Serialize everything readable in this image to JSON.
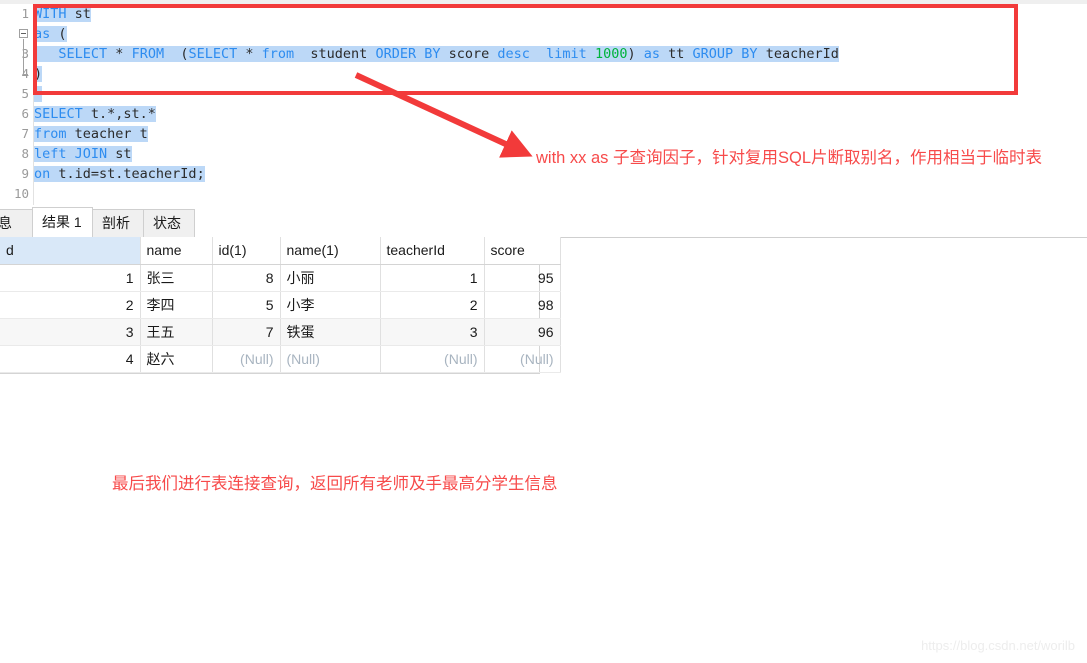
{
  "editor": {
    "line_numbers": [
      "1",
      "2",
      "3",
      "4",
      "5",
      "6",
      "7",
      "8",
      "9",
      "10"
    ],
    "lines": [
      {
        "n": "1",
        "text": "WITH st"
      },
      {
        "n": "2",
        "text": "as ("
      },
      {
        "n": "3",
        "text": "   SELECT * FROM  (SELECT * from  student ORDER BY score desc  limit 1000) as tt GROUP BY teacherId"
      },
      {
        "n": "4",
        "text": ")"
      },
      {
        "n": "5",
        "text": ""
      },
      {
        "n": "6",
        "text": "SELECT t.*,st.*"
      },
      {
        "n": "7",
        "text": "from teacher t"
      },
      {
        "n": "8",
        "text": "left JOIN st"
      },
      {
        "n": "9",
        "text": "on t.id=st.teacherId;"
      },
      {
        "n": "10",
        "text": ""
      }
    ],
    "tokens": {
      "l1": [
        {
          "t": "WITH",
          "c": "kw"
        },
        {
          "t": " st",
          "c": "plain"
        }
      ],
      "l2": [
        {
          "t": "as",
          "c": "kw"
        },
        {
          "t": " (",
          "c": "plain"
        }
      ],
      "l3": [
        {
          "t": "   ",
          "c": "plain"
        },
        {
          "t": "SELECT",
          "c": "kw"
        },
        {
          "t": " * ",
          "c": "plain"
        },
        {
          "t": "FROM",
          "c": "kw"
        },
        {
          "t": "  (",
          "c": "plain"
        },
        {
          "t": "SELECT",
          "c": "kw"
        },
        {
          "t": " * ",
          "c": "plain"
        },
        {
          "t": "from",
          "c": "kw"
        },
        {
          "t": "  student ",
          "c": "plain"
        },
        {
          "t": "ORDER",
          "c": "kw"
        },
        {
          "t": " ",
          "c": "plain"
        },
        {
          "t": "BY",
          "c": "kw"
        },
        {
          "t": " score ",
          "c": "plain"
        },
        {
          "t": "desc",
          "c": "kw"
        },
        {
          "t": "  ",
          "c": "plain"
        },
        {
          "t": "limit",
          "c": "kw"
        },
        {
          "t": " ",
          "c": "plain"
        },
        {
          "t": "1000",
          "c": "num"
        },
        {
          "t": ") ",
          "c": "plain"
        },
        {
          "t": "as",
          "c": "kw"
        },
        {
          "t": " tt ",
          "c": "plain"
        },
        {
          "t": "GROUP",
          "c": "kw"
        },
        {
          "t": " ",
          "c": "plain"
        },
        {
          "t": "BY",
          "c": "kw"
        },
        {
          "t": " teacherId",
          "c": "plain"
        }
      ],
      "l4": [
        {
          "t": ")",
          "c": "plain"
        }
      ],
      "l6": [
        {
          "t": "SELECT",
          "c": "kw"
        },
        {
          "t": " t.*,st.*",
          "c": "plain"
        }
      ],
      "l7": [
        {
          "t": "from",
          "c": "kw"
        },
        {
          "t": " teacher t",
          "c": "plain"
        }
      ],
      "l8": [
        {
          "t": "left",
          "c": "kw"
        },
        {
          "t": " ",
          "c": "plain"
        },
        {
          "t": "JOIN",
          "c": "kw"
        },
        {
          "t": " st",
          "c": "plain"
        }
      ],
      "l9": [
        {
          "t": "on",
          "c": "kw"
        },
        {
          "t": " t.id=st.teacherId;",
          "c": "plain"
        }
      ]
    }
  },
  "annotations": {
    "box_color": "#f23a3a",
    "arrow_color": "#f23a3a",
    "text_color": "#f74a4a",
    "callout_top": "with xx as 子查询因子，针对复用SQL片断取别名，作用相当于临时表",
    "callout_bottom": "最后我们进行表连接查询，返回所有老师及手最高分学生信息"
  },
  "tabs": [
    {
      "label": "息",
      "active": false
    },
    {
      "label": "结果 1",
      "active": true
    },
    {
      "label": "剖析",
      "active": false
    },
    {
      "label": "状态",
      "active": false
    }
  ],
  "result_grid": {
    "columns": [
      "d",
      "name",
      "id(1)",
      "name(1)",
      "teacherId",
      "score"
    ],
    "rows": [
      {
        "cells": [
          {
            "v": "1",
            "type": "num"
          },
          {
            "v": "张三",
            "type": "txt"
          },
          {
            "v": "8",
            "type": "num"
          },
          {
            "v": "小丽",
            "type": "txt"
          },
          {
            "v": "1",
            "type": "num"
          },
          {
            "v": "95",
            "type": "num"
          }
        ]
      },
      {
        "cells": [
          {
            "v": "2",
            "type": "num"
          },
          {
            "v": "李四",
            "type": "txt"
          },
          {
            "v": "5",
            "type": "num"
          },
          {
            "v": "小李",
            "type": "txt"
          },
          {
            "v": "2",
            "type": "num"
          },
          {
            "v": "98",
            "type": "num"
          }
        ]
      },
      {
        "cells": [
          {
            "v": "3",
            "type": "num"
          },
          {
            "v": "王五",
            "type": "txt"
          },
          {
            "v": "7",
            "type": "num"
          },
          {
            "v": "铁蛋",
            "type": "txt"
          },
          {
            "v": "3",
            "type": "num"
          },
          {
            "v": "96",
            "type": "num"
          }
        ]
      },
      {
        "cells": [
          {
            "v": "4",
            "type": "num"
          },
          {
            "v": "赵六",
            "type": "txt"
          },
          {
            "v": "(Null)",
            "type": "null"
          },
          {
            "v": "(Null)",
            "type": "null"
          },
          {
            "v": "(Null)",
            "type": "null"
          },
          {
            "v": "(Null)",
            "type": "null"
          }
        ]
      }
    ]
  },
  "watermark": "https://blog.csdn.net/worilb"
}
